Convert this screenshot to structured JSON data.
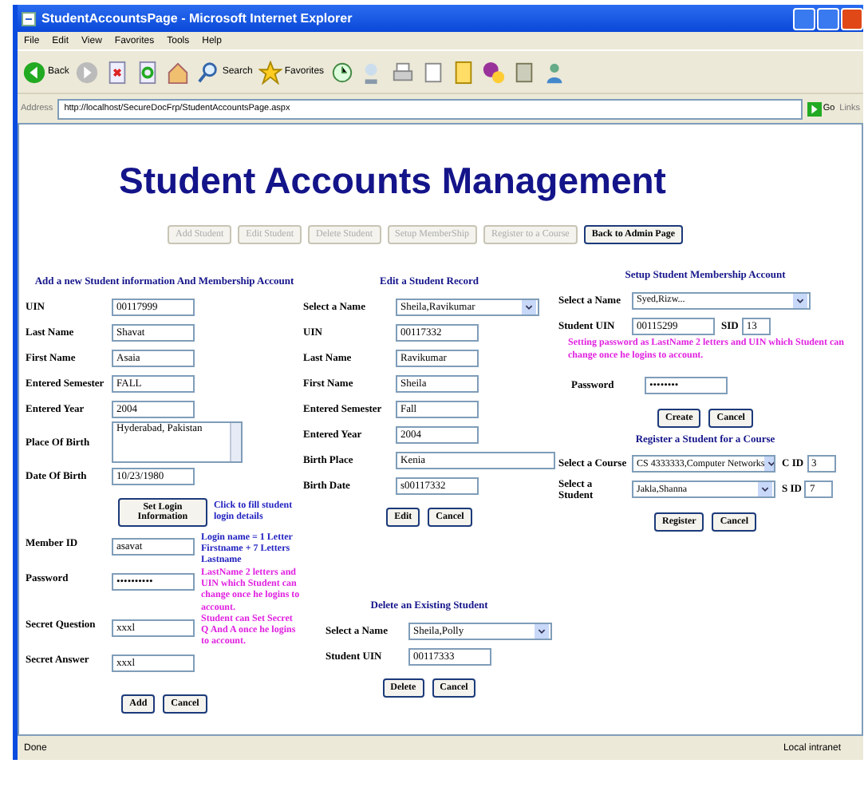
{
  "window": {
    "title": "StudentAccountsPage - Microsoft Internet Explorer"
  },
  "menu": [
    "File",
    "Edit",
    "View",
    "Favorites",
    "Tools",
    "Help"
  ],
  "toolbar": {
    "back": "Back",
    "search": "Search",
    "favorites": "Favorites"
  },
  "address_bar": {
    "label": "Address",
    "url": "http://localhost/SecureDocFrp/StudentAccountsPage.aspx",
    "go": "Go",
    "links": "Links"
  },
  "heading": "Student Accounts Management",
  "nav_buttons": [
    {
      "label": "Add Student",
      "disabled": true
    },
    {
      "label": "Edit Student",
      "disabled": true
    },
    {
      "label": "Delete Student",
      "disabled": true
    },
    {
      "label": "Setup MemberShip",
      "disabled": true
    },
    {
      "label": "Register to a Course",
      "disabled": true
    },
    {
      "label": "Back to Admin Page",
      "disabled": false
    }
  ],
  "add_section": {
    "title": "Add a new Student information And Membership Account",
    "fields": [
      {
        "label": "UIN",
        "value": "00117999",
        "kind": "text"
      },
      {
        "label": "Last Name",
        "value": "Shavat",
        "kind": "text"
      },
      {
        "label": "First Name",
        "value": "Asaia",
        "kind": "text"
      },
      {
        "label": "Entered Semester",
        "value": "FALL",
        "kind": "text"
      },
      {
        "label": "Entered Year",
        "value": "2004",
        "kind": "text"
      },
      {
        "label": "Place Of Birth",
        "value": "Hyderabad, Pakistan",
        "kind": "textarea"
      },
      {
        "label": "Date Of Birth",
        "value": "10/23/1980",
        "kind": "text"
      }
    ],
    "login_button": "Set Login Information",
    "login_note": "Click to fill student login details",
    "login_fields": [
      {
        "label": "Member ID",
        "value": "asavat",
        "note": "Login name = 1 Letter Firstname + 7 Letters Lastname",
        "color": "#2020c0"
      },
      {
        "label": "Password",
        "value": "••••••••••",
        "note": "LastName 2 letters and UIN which Student can change once he logins to account.",
        "color": "#e020e0"
      },
      {
        "label": "Secret Question",
        "value": "xxxl",
        "note": "Student can Set Secret Q And A once he logins to account.",
        "color": "#e020e0"
      },
      {
        "label": "Secret Answer",
        "value": "xxxl"
      }
    ],
    "buttons": [
      "Add",
      "Cancel"
    ]
  },
  "edit_section": {
    "title": "Edit a Student Record",
    "fields": [
      {
        "label": "Select a Name",
        "value": "Sheila,Ravikumar",
        "kind": "select"
      },
      {
        "label": "UIN",
        "value": "00117332",
        "kind": "text"
      },
      {
        "label": "Last Name",
        "value": "Ravikumar",
        "kind": "text"
      },
      {
        "label": "First Name",
        "value": "Sheila",
        "kind": "text"
      },
      {
        "label": "Entered Semester",
        "value": "Fall",
        "kind": "text"
      },
      {
        "label": "Entered Year",
        "value": "2004",
        "kind": "text"
      },
      {
        "label": "Birth Place",
        "value": "Kenia",
        "kind": "wide"
      },
      {
        "label": "Birth Date",
        "value": "s00117332",
        "kind": "text"
      }
    ],
    "buttons": [
      "Edit",
      "Cancel"
    ]
  },
  "delete_section": {
    "title": "Delete an Existing Student",
    "fields": [
      {
        "label": "Select a Name",
        "value": "Sheila,Polly",
        "kind": "select"
      },
      {
        "label": "Student UIN",
        "value": "00117333",
        "kind": "text"
      }
    ],
    "buttons": [
      "Delete",
      "Cancel"
    ]
  },
  "setup_section": {
    "title": "Setup Student Membership Account",
    "name_label": "Select a Name",
    "name_value": "Syed,Rizw...",
    "uin_label": "Student UIN",
    "uin_value": "00115299",
    "sid_label": "SID",
    "sid_value": "13",
    "note": "Setting password as LastName 2 letters and UIN which Student can change once he logins to account.",
    "password_label": "Password",
    "password_value": "••••••••",
    "buttons": [
      "Create",
      "Cancel"
    ]
  },
  "register_section": {
    "title": "Register a Student for a Course",
    "rows": [
      {
        "label": "Select a Course",
        "value": "CS 4333333,Computer Networks",
        "id_label": "C ID",
        "id_value": "3"
      },
      {
        "label": "Select a Student",
        "value": "Jakla,Shanna",
        "id_label": "S ID",
        "id_value": "7"
      }
    ],
    "buttons": [
      "Register",
      "Cancel"
    ]
  },
  "status_bar": {
    "text": "Done",
    "zone": "Local intranet"
  }
}
